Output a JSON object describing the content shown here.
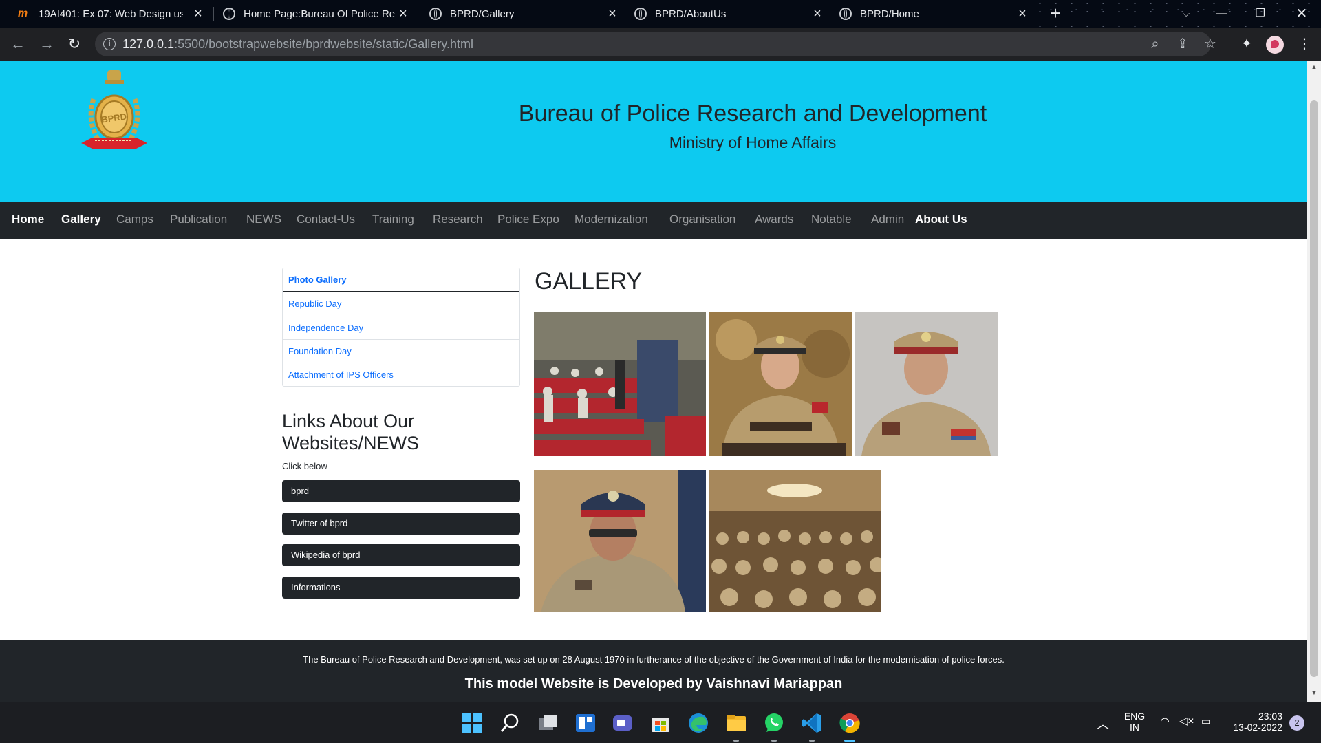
{
  "browser": {
    "tabs": [
      {
        "title": "19AI401: Ex 07: Web Design usin",
        "icon": "moodle-icon"
      },
      {
        "title": "Home Page:Bureau Of Police Res",
        "icon": "globe-icon"
      },
      {
        "title": "BPRD/Gallery",
        "icon": "globe-icon"
      },
      {
        "title": "BPRD/AboutUs",
        "icon": "globe-icon"
      },
      {
        "title": "BPRD/Home",
        "icon": "globe-icon"
      }
    ],
    "url_host": "127.0.0.1",
    "url_path": ":5500/bootstrapwebsite/bprdwebsite/static/Gallery.html"
  },
  "site": {
    "title": "Bureau of Police Research and Development",
    "subtitle": "Ministry of Home Affairs",
    "nav": [
      "Home",
      "Gallery",
      "Camps",
      "Publication",
      "NEWS",
      "Contact-Us",
      "Training",
      "Research",
      "Police Expo",
      "Modernization",
      "Organisation",
      "Awards",
      "Notable",
      "Admin",
      "About Us"
    ],
    "nav_active": [
      "Home",
      "Gallery",
      "About Us"
    ]
  },
  "sidebar": {
    "items": [
      "Photo Gallery",
      "Republic Day",
      "Independence Day",
      "Foundation Day",
      "Attachment of IPS Officers"
    ],
    "links_heading": "Links About Our Websites/NEWS",
    "links_sub": "Click below",
    "buttons": [
      "bprd",
      "Twitter of bprd",
      "Wikipedia of bprd",
      "Informations"
    ]
  },
  "gallery": {
    "heading": "GALLERY",
    "photos": [
      "auditorium-photo",
      "woman-officer-photo",
      "officer-photo",
      "senior-officer-photo",
      "conference-photo"
    ]
  },
  "footer": {
    "line1": "The Bureau of Police Research and Development, was set up on 28 August 1970 in furtherance of the objective of the Government of India for the modernisation of police forces.",
    "line2": "This model Website is Developed by Vaishnavi Mariappan"
  },
  "taskbar": {
    "lang1": "ENG",
    "lang2": "IN",
    "time": "23:03",
    "date": "13-02-2022",
    "notifications": "2"
  },
  "colors": {
    "header_bg": "#0dcaf0",
    "nav_bg": "#212529",
    "link": "#0d6efd"
  }
}
